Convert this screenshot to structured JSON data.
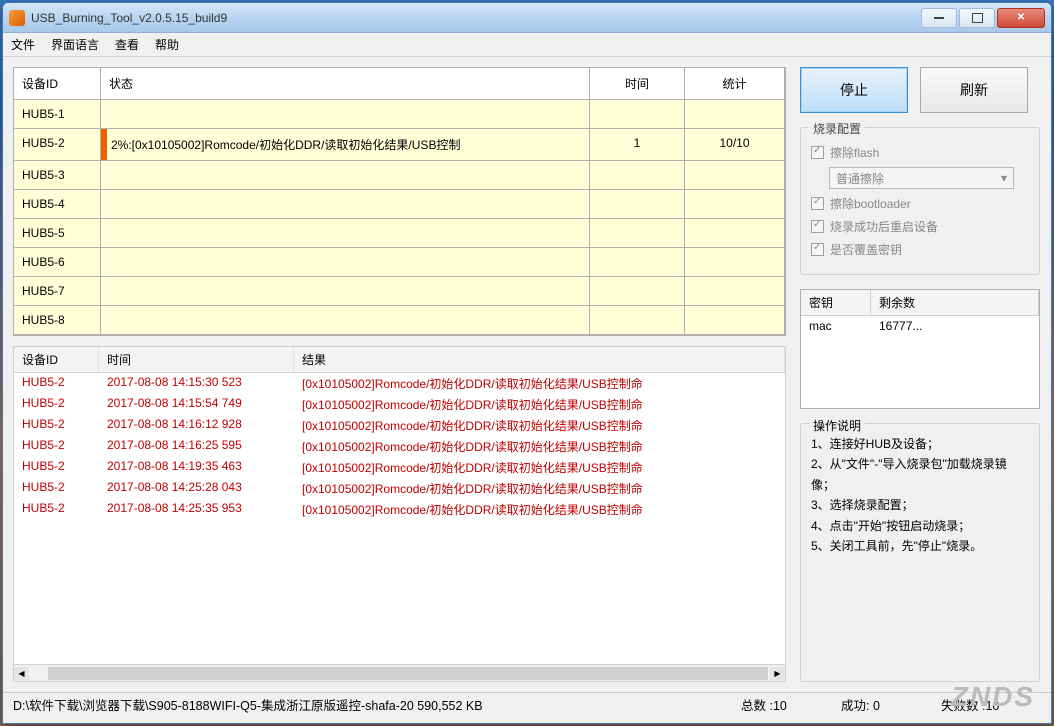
{
  "window": {
    "title": "USB_Burning_Tool_v2.0.5.15_build9"
  },
  "menu": [
    "文件",
    "界面语言",
    "查看",
    "帮助"
  ],
  "device_table": {
    "headers": {
      "id": "设备ID",
      "status": "状态",
      "time": "时间",
      "stat": "统计"
    },
    "rows": [
      {
        "id": "HUB5-1",
        "status": "",
        "time": "",
        "stat": ""
      },
      {
        "id": "HUB5-2",
        "status": "2%:[0x10105002]Romcode/初始化DDR/读取初始化结果/USB控制",
        "time": "1",
        "stat": "10/10",
        "progress": true
      },
      {
        "id": "HUB5-3",
        "status": "",
        "time": "",
        "stat": ""
      },
      {
        "id": "HUB5-4",
        "status": "",
        "time": "",
        "stat": ""
      },
      {
        "id": "HUB5-5",
        "status": "",
        "time": "",
        "stat": ""
      },
      {
        "id": "HUB5-6",
        "status": "",
        "time": "",
        "stat": ""
      },
      {
        "id": "HUB5-7",
        "status": "",
        "time": "",
        "stat": ""
      },
      {
        "id": "HUB5-8",
        "status": "",
        "time": "",
        "stat": ""
      }
    ]
  },
  "log_table": {
    "headers": {
      "id": "设备ID",
      "time": "时间",
      "result": "结果"
    },
    "rows": [
      {
        "id": "HUB5-2",
        "time": "2017-08-08 14:15:30 523",
        "result": "[0x10105002]Romcode/初始化DDR/读取初始化结果/USB控制命"
      },
      {
        "id": "HUB5-2",
        "time": "2017-08-08 14:15:54 749",
        "result": "[0x10105002]Romcode/初始化DDR/读取初始化结果/USB控制命"
      },
      {
        "id": "HUB5-2",
        "time": "2017-08-08 14:16:12 928",
        "result": "[0x10105002]Romcode/初始化DDR/读取初始化结果/USB控制命"
      },
      {
        "id": "HUB5-2",
        "time": "2017-08-08 14:16:25 595",
        "result": "[0x10105002]Romcode/初始化DDR/读取初始化结果/USB控制命"
      },
      {
        "id": "HUB5-2",
        "time": "2017-08-08 14:19:35 463",
        "result": "[0x10105002]Romcode/初始化DDR/读取初始化结果/USB控制命"
      },
      {
        "id": "HUB5-2",
        "time": "2017-08-08 14:25:28 043",
        "result": "[0x10105002]Romcode/初始化DDR/读取初始化结果/USB控制命"
      },
      {
        "id": "HUB5-2",
        "time": "2017-08-08 14:25:35 953",
        "result": "[0x10105002]Romcode/初始化DDR/读取初始化结果/USB控制命"
      }
    ]
  },
  "buttons": {
    "stop": "停止",
    "refresh": "刷新"
  },
  "config": {
    "legend": "烧录配置",
    "erase_flash": "擦除flash",
    "erase_mode": "普通擦除",
    "erase_bootloader": "擦除bootloader",
    "reboot_after": "烧录成功后重启设备",
    "overwrite_key": "是否覆盖密钥"
  },
  "key_table": {
    "h1": "密钥",
    "h2": "剩余数",
    "row": {
      "name": "mac",
      "count": "16777..."
    }
  },
  "instructions": {
    "legend": "操作说明",
    "lines": [
      "1、连接好HUB及设备；",
      "2、从\"文件\"-\"导入烧录包\"加载烧录镜像；",
      "3、选择烧录配置；",
      "4、点击\"开始\"按钮启动烧录；",
      "5、关闭工具前，先\"停止\"烧录。"
    ]
  },
  "statusbar": {
    "path": "D:\\软件下载\\浏览器下载\\S905-8188WIFI-Q5-集成浙江原版遥控-shafa-20 590,552 KB",
    "total": "总数 :10",
    "success": "成功:  0",
    "fail": "失败数 :10"
  },
  "watermark": "ZNDS"
}
